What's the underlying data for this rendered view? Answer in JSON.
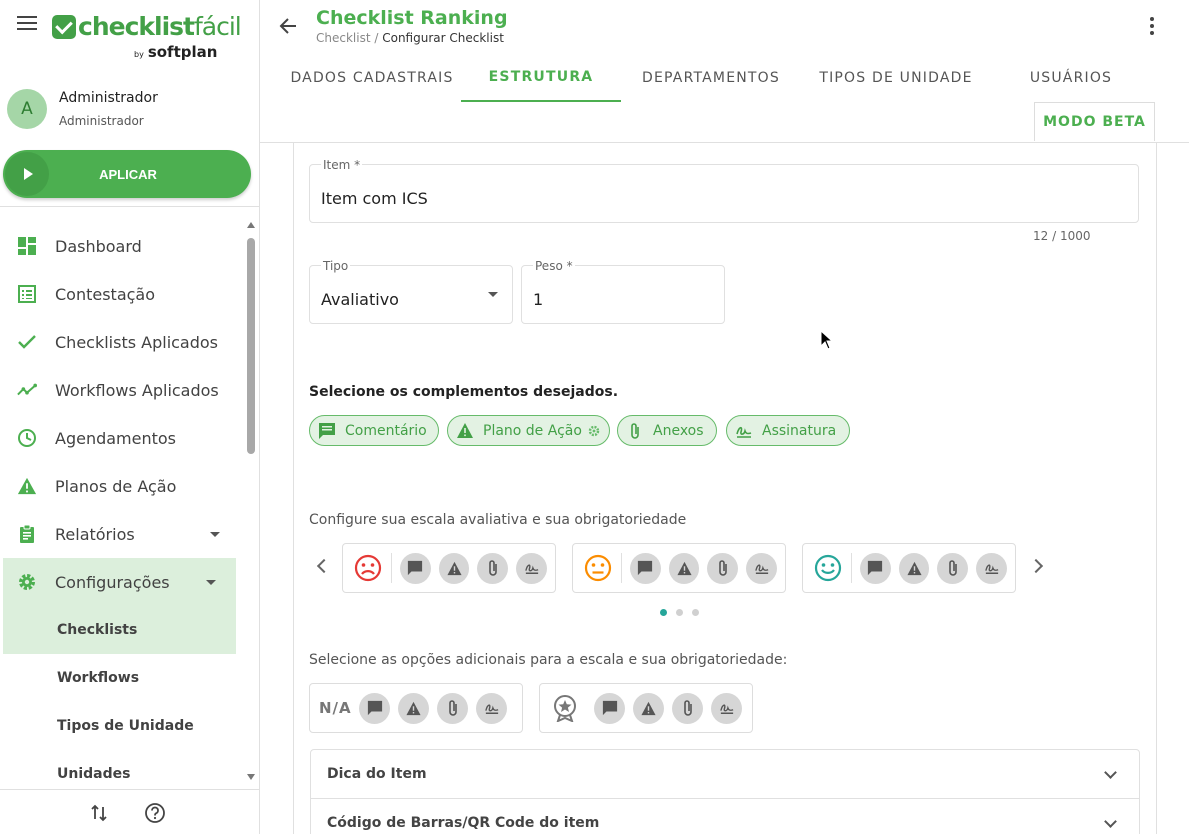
{
  "brand": {
    "logo_main": "checklist",
    "logo_light": "fácil",
    "logo_by": "by",
    "logo_sub": "softplan"
  },
  "user": {
    "initial": "A",
    "name": "Administrador",
    "role": "Administrador"
  },
  "apply_label": "APLICAR",
  "nav": [
    {
      "label": "Dashboard",
      "icon": "dashboard-icon"
    },
    {
      "label": "Contestação",
      "icon": "list-icon"
    },
    {
      "label": "Checklists Aplicados",
      "icon": "check-icon"
    },
    {
      "label": "Workflows Aplicados",
      "icon": "trending-icon"
    },
    {
      "label": "Agendamentos",
      "icon": "clock-icon"
    },
    {
      "label": "Planos de Ação",
      "icon": "warning-icon"
    },
    {
      "label": "Relatórios",
      "icon": "clipboard-icon"
    },
    {
      "label": "Configurações",
      "icon": "gear-icon"
    }
  ],
  "nav_sub": [
    "Checklists",
    "Workflows",
    "Tipos de Unidade",
    "Unidades"
  ],
  "header": {
    "title": "Checklist Ranking",
    "crumb_parent": "Checklist",
    "crumb_sep": " / ",
    "crumb_current": "Configurar Checklist"
  },
  "tabs": [
    "DADOS CADASTRAIS",
    "ESTRUTURA",
    "DEPARTAMENTOS",
    "TIPOS DE UNIDADE",
    "USUÁRIOS"
  ],
  "beta_label": "MODO BETA",
  "form": {
    "item_label": "Item *",
    "item_value": "Item com ICS",
    "item_counter": "12 / 1000",
    "tipo_label": "Tipo",
    "tipo_value": "Avaliativo",
    "peso_label": "Peso *",
    "peso_value": "1"
  },
  "complements_title": "Selecione os complementos desejados.",
  "chips": [
    "Comentário",
    "Plano de Ação",
    "Anexos",
    "Assinatura"
  ],
  "scale_title": "Configure sua escala avaliativa e sua obrigatoriedade",
  "additional_title": "Selecione as opções adicionais para a escala e sua obrigatoriedade:",
  "na_label": "N/A",
  "expanders": [
    "Dica do Item",
    "Código de Barras/QR Code do item"
  ],
  "colors": {
    "accent": "#4caf50",
    "sad": "#e53935",
    "neutral": "#fb8c00",
    "happy": "#26a69a"
  }
}
